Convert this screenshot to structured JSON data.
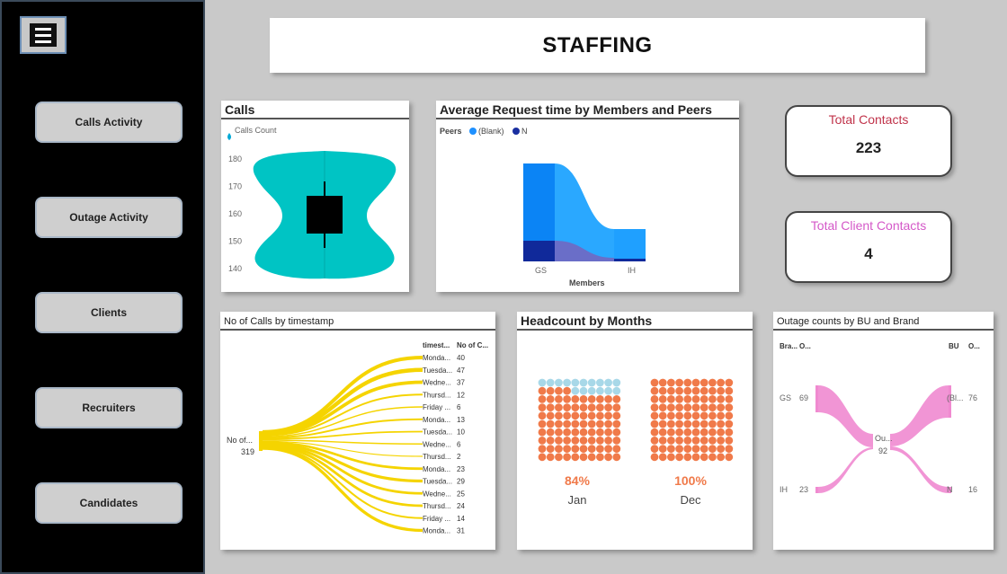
{
  "sidebar": {
    "items": [
      {
        "label": "Calls Activity"
      },
      {
        "label": "Outage Activity"
      },
      {
        "label": "Clients"
      },
      {
        "label": "Recruiters"
      },
      {
        "label": "Candidates"
      }
    ]
  },
  "header": {
    "title": "STAFFING"
  },
  "kpis": {
    "total_contacts": {
      "label": "Total Contacts",
      "value": "223",
      "color": "#c0334a"
    },
    "total_client_contacts": {
      "label": "Total Client Contacts",
      "value": "4",
      "color": "#d458c8"
    }
  },
  "calls": {
    "title": "Calls",
    "legend": "Calls Count",
    "color": "#00c4c4",
    "chart_data": {
      "type": "violin",
      "y_ticks": [
        "180",
        "170",
        "160",
        "150",
        "140"
      ]
    }
  },
  "avg_request": {
    "title": "Average Request time by Members and Peers",
    "legend_title": "Peers",
    "legend_items": [
      {
        "label": "(Blank)",
        "color": "#1e90ff"
      },
      {
        "label": "N",
        "color": "#1a2fa0"
      }
    ],
    "x_label": "Members",
    "chart_data": {
      "type": "ribbon",
      "categories": [
        "GS",
        "IH"
      ]
    }
  },
  "calls_timestamp": {
    "title": "No of Calls by timestamp",
    "source_label": "No of...",
    "source_value": "319",
    "col1_header": "timest...",
    "col2_header": "No of C...",
    "color": "#f5d400",
    "chart_data": {
      "type": "decomposition",
      "rows": [
        {
          "label": "Monda...",
          "value": "40"
        },
        {
          "label": "Tuesda...",
          "value": "47"
        },
        {
          "label": "Wedne...",
          "value": "37"
        },
        {
          "label": "Thursd...",
          "value": "12"
        },
        {
          "label": "Friday ...",
          "value": "6"
        },
        {
          "label": "Monda...",
          "value": "13"
        },
        {
          "label": "Tuesda...",
          "value": "10"
        },
        {
          "label": "Wedne...",
          "value": "6"
        },
        {
          "label": "Thursd...",
          "value": "2"
        },
        {
          "label": "Monda...",
          "value": "23"
        },
        {
          "label": "Tuesda...",
          "value": "29"
        },
        {
          "label": "Wedne...",
          "value": "25"
        },
        {
          "label": "Thursd...",
          "value": "24"
        },
        {
          "label": "Friday ...",
          "value": "14"
        },
        {
          "label": "Monda...",
          "value": "31"
        }
      ]
    }
  },
  "headcount": {
    "title": "Headcount by Months",
    "fill_color": "#f07a4a",
    "empty_color": "#a8d8e8",
    "chart_data": {
      "type": "waffle",
      "items": [
        {
          "month": "Jan",
          "percent_label": "84%",
          "fraction": 0.84
        },
        {
          "month": "Dec",
          "percent_label": "100%",
          "fraction": 1.0
        }
      ]
    }
  },
  "outage": {
    "title": "Outage counts by BU and Brand",
    "left_header_a": "Bra...",
    "left_header_b": "O...",
    "right_header_a": "BU",
    "right_header_b": "O...",
    "center_label": "Ou...",
    "center_value": "92",
    "color": "#f08ad0",
    "chart_data": {
      "type": "sankey",
      "left": [
        {
          "label": "GS",
          "value": "69"
        },
        {
          "label": "IH",
          "value": "23"
        }
      ],
      "right": [
        {
          "label": "(Bl...",
          "value": "76"
        },
        {
          "label": "N",
          "value": "16"
        }
      ]
    }
  }
}
